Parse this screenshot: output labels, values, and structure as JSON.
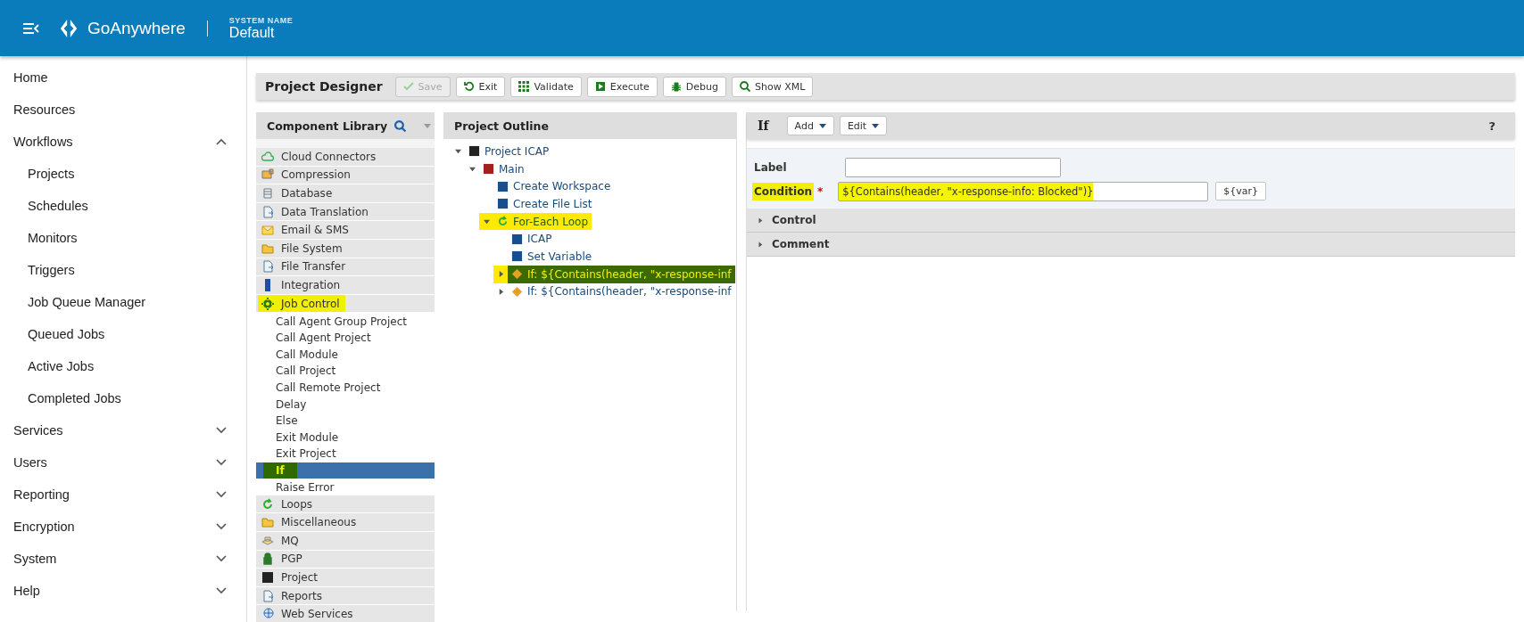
{
  "header": {
    "product": "GoAnywhere",
    "system_label": "SYSTEM NAME",
    "system_name": "Default"
  },
  "sidebar": {
    "items": [
      {
        "label": "Home",
        "kind": "link"
      },
      {
        "label": "Resources",
        "kind": "link"
      },
      {
        "label": "Workflows",
        "kind": "group",
        "expanded": true,
        "children": [
          {
            "label": "Projects"
          },
          {
            "label": "Schedules"
          },
          {
            "label": "Monitors"
          },
          {
            "label": "Triggers"
          },
          {
            "label": "Job Queue Manager"
          },
          {
            "label": "Queued Jobs"
          },
          {
            "label": "Active Jobs"
          },
          {
            "label": "Completed Jobs"
          }
        ]
      },
      {
        "label": "Services",
        "kind": "group",
        "expanded": false
      },
      {
        "label": "Users",
        "kind": "group",
        "expanded": false
      },
      {
        "label": "Reporting",
        "kind": "group",
        "expanded": false
      },
      {
        "label": "Encryption",
        "kind": "group",
        "expanded": false
      },
      {
        "label": "System",
        "kind": "group",
        "expanded": false
      },
      {
        "label": "Help",
        "kind": "group",
        "expanded": false
      }
    ]
  },
  "toolbar": {
    "title": "Project Designer",
    "buttons": [
      {
        "label": "Save",
        "disabled": true
      },
      {
        "label": "Exit",
        "disabled": false
      },
      {
        "label": "Validate",
        "disabled": false
      },
      {
        "label": "Execute",
        "disabled": false
      },
      {
        "label": "Debug",
        "disabled": false
      },
      {
        "label": "Show XML",
        "disabled": false
      }
    ]
  },
  "library": {
    "title": "Component Library",
    "categories": [
      {
        "label": "Cloud Connectors",
        "highlighted": false
      },
      {
        "label": "Compression",
        "highlighted": false
      },
      {
        "label": "Database",
        "highlighted": false
      },
      {
        "label": "Data Translation",
        "highlighted": false
      },
      {
        "label": "Email & SMS",
        "highlighted": false
      },
      {
        "label": "File System",
        "highlighted": false
      },
      {
        "label": "File Transfer",
        "highlighted": false
      },
      {
        "label": "Integration",
        "highlighted": false
      },
      {
        "label": "Job Control",
        "highlighted": true,
        "children": [
          {
            "label": "Call Agent Group Project",
            "selected": false,
            "highlighted": false
          },
          {
            "label": "Call Agent Project",
            "selected": false,
            "highlighted": false
          },
          {
            "label": "Call Module",
            "selected": false,
            "highlighted": false
          },
          {
            "label": "Call Project",
            "selected": false,
            "highlighted": false
          },
          {
            "label": "Call Remote Project",
            "selected": false,
            "highlighted": false
          },
          {
            "label": "Delay",
            "selected": false,
            "highlighted": false
          },
          {
            "label": "Else",
            "selected": false,
            "highlighted": false
          },
          {
            "label": "Exit Module",
            "selected": false,
            "highlighted": false
          },
          {
            "label": "Exit Project",
            "selected": false,
            "highlighted": false
          },
          {
            "label": "If",
            "selected": true,
            "highlighted": true
          },
          {
            "label": "Raise Error",
            "selected": false,
            "highlighted": false
          }
        ]
      },
      {
        "label": "Loops",
        "highlighted": false
      },
      {
        "label": "Miscellaneous",
        "highlighted": false
      },
      {
        "label": "MQ",
        "highlighted": false
      },
      {
        "label": "PGP",
        "highlighted": false
      },
      {
        "label": "Project",
        "highlighted": false
      },
      {
        "label": "Reports",
        "highlighted": false
      },
      {
        "label": "Web Services",
        "highlighted": false
      }
    ]
  },
  "outline": {
    "title": "Project Outline",
    "nodes": [
      {
        "label": "Project ICAP",
        "kind": "project",
        "expanded": true,
        "selected": false,
        "highlighted": false,
        "children": [
          {
            "label": "Main",
            "kind": "module",
            "expanded": true,
            "selected": false,
            "highlighted": false,
            "children": [
              {
                "label": "Create Workspace",
                "kind": "task",
                "selected": false,
                "highlighted": false
              },
              {
                "label": "Create File List",
                "kind": "task",
                "selected": false,
                "highlighted": false
              },
              {
                "label": "For-Each Loop",
                "kind": "loop",
                "expanded": true,
                "selected": false,
                "highlighted": true,
                "children": [
                  {
                    "label": "ICAP",
                    "kind": "task",
                    "selected": false,
                    "highlighted": false
                  },
                  {
                    "label": "Set Variable",
                    "kind": "task",
                    "selected": false,
                    "highlighted": false
                  },
                  {
                    "label": "If: ${Contains(header, \"x-response-inf",
                    "kind": "condition",
                    "expanded": false,
                    "selected": true,
                    "highlighted": true
                  },
                  {
                    "label": "If: ${Contains(header, \"x-response-inf",
                    "kind": "condition",
                    "expanded": false,
                    "selected": false,
                    "highlighted": false
                  }
                ]
              }
            ]
          }
        ]
      }
    ]
  },
  "editor": {
    "title": "If",
    "menus": [
      "Add",
      "Edit"
    ],
    "help": "?",
    "fields": [
      {
        "label": "Label",
        "highlighted": false
      },
      {
        "label": "Condition",
        "required_mark": "*",
        "value": "${Contains(header, \"x-response-info: Blocked\")}",
        "highlighted": true,
        "button": "${var}"
      }
    ],
    "sections": [
      {
        "label": "Control",
        "expanded": false
      },
      {
        "label": "Comment",
        "expanded": false
      }
    ]
  }
}
